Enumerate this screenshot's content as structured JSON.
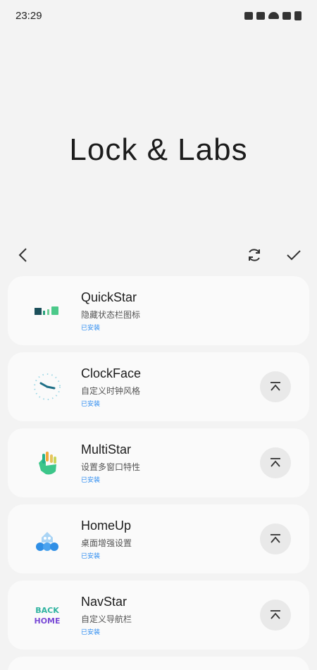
{
  "status": {
    "time": "23:29"
  },
  "title": "Lock & Labs",
  "modules": [
    {
      "name": "QuickStar",
      "desc": "隐藏状态栏图标",
      "state": "已安装",
      "icon": "quickstar-icon",
      "has_action": false
    },
    {
      "name": "ClockFace",
      "desc": "自定义时钟风格",
      "state": "已安装",
      "icon": "clockface-icon",
      "has_action": true
    },
    {
      "name": "MultiStar",
      "desc": "设置多窗口特性",
      "state": "已安装",
      "icon": "multistar-icon",
      "has_action": true
    },
    {
      "name": "HomeUp",
      "desc": "桌面增强设置",
      "state": "已安装",
      "icon": "homeup-icon",
      "has_action": true
    },
    {
      "name": "NavStar",
      "desc": "自定义导航栏",
      "state": "已安装",
      "icon": "navstar-icon",
      "has_action": true
    }
  ],
  "navstar_logo_text": [
    "BACK",
    "HOME"
  ],
  "colors": {
    "background": "#f3f3f3",
    "card": "#fafafa",
    "accent": "#2d8cf0",
    "action_bg": "#e9e9e9"
  }
}
